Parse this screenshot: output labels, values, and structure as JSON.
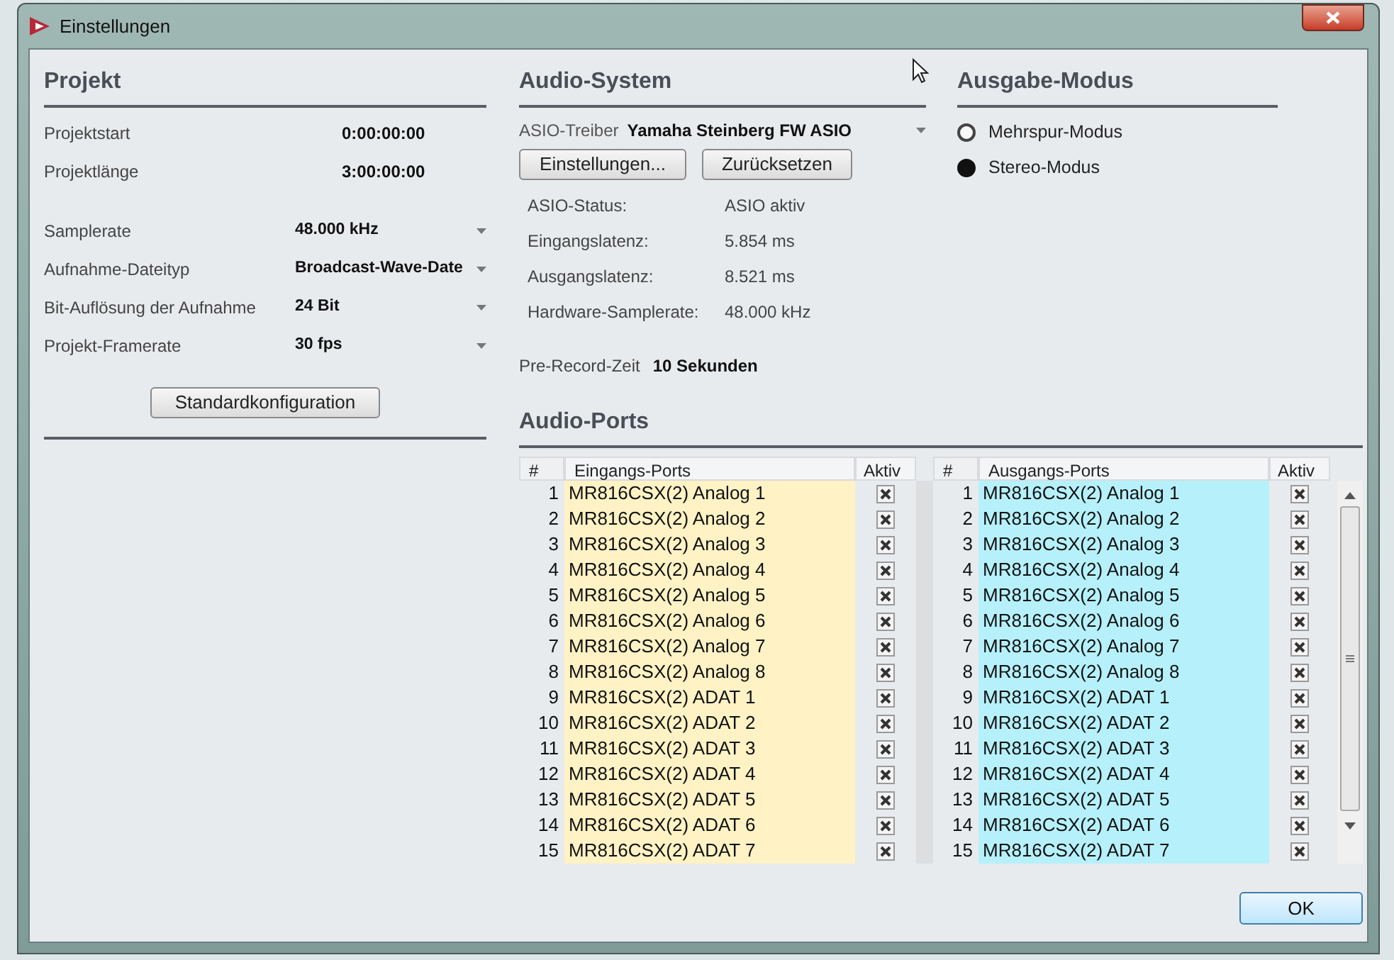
{
  "window": {
    "title": "Einstellungen"
  },
  "projekt": {
    "title": "Projekt",
    "times": [
      {
        "label": "Projektstart",
        "value": "0:00:00:00"
      },
      {
        "label": "Projektlänge",
        "value": "3:00:00:00"
      }
    ],
    "settings": [
      {
        "label": "Samplerate",
        "value": "48.000 kHz"
      },
      {
        "label": "Aufnahme-Dateityp",
        "value": "Broadcast-Wave-Date"
      },
      {
        "label": "Bit-Auflösung der Aufnahme",
        "value": "24 Bit"
      },
      {
        "label": "Projekt-Framerate",
        "value": "30 fps"
      }
    ],
    "button": "Standardkonfiguration"
  },
  "audio_system": {
    "title": "Audio-System",
    "driver_label": "ASIO-Treiber",
    "driver_value": "Yamaha Steinberg FW ASIO",
    "buttons": [
      "Einstellungen...",
      "Zurücksetzen"
    ],
    "status": [
      {
        "label": "ASIO-Status:",
        "value": "ASIO aktiv"
      },
      {
        "label": "Eingangslatenz:",
        "value": "5.854 ms"
      },
      {
        "label": "Ausgangslatenz:",
        "value": "8.521 ms"
      },
      {
        "label": "Hardware-Samplerate:",
        "value": "48.000 kHz"
      }
    ],
    "pre_record_label": "Pre-Record-Zeit",
    "pre_record_value": "10 Sekunden"
  },
  "ausgabe_modus": {
    "title": "Ausgabe-Modus",
    "options": [
      {
        "label": "Mehrspur-Modus",
        "selected": false
      },
      {
        "label": "Stereo-Modus",
        "selected": true
      }
    ]
  },
  "audio_ports": {
    "title": "Audio-Ports",
    "tables": [
      {
        "color": "#fff2c4",
        "columns": [
          "#",
          "Eingangs-Ports",
          "Aktiv"
        ],
        "rows": [
          {
            "number": "1",
            "name": "MR816CSX(2) Analog 1",
            "active": true
          },
          {
            "number": "2",
            "name": "MR816CSX(2) Analog 2",
            "active": true
          },
          {
            "number": "3",
            "name": "MR816CSX(2) Analog 3",
            "active": true
          },
          {
            "number": "4",
            "name": "MR816CSX(2) Analog 4",
            "active": true
          },
          {
            "number": "5",
            "name": "MR816CSX(2) Analog 5",
            "active": true
          },
          {
            "number": "6",
            "name": "MR816CSX(2) Analog 6",
            "active": true
          },
          {
            "number": "7",
            "name": "MR816CSX(2) Analog 7",
            "active": true
          },
          {
            "number": "8",
            "name": "MR816CSX(2) Analog 8",
            "active": true
          },
          {
            "number": "9",
            "name": "MR816CSX(2) ADAT 1",
            "active": true
          },
          {
            "number": "10",
            "name": "MR816CSX(2) ADAT 2",
            "active": true
          },
          {
            "number": "11",
            "name": "MR816CSX(2) ADAT 3",
            "active": true
          },
          {
            "number": "12",
            "name": "MR816CSX(2) ADAT 4",
            "active": true
          },
          {
            "number": "13",
            "name": "MR816CSX(2) ADAT 5",
            "active": true
          },
          {
            "number": "14",
            "name": "MR816CSX(2) ADAT 6",
            "active": true
          },
          {
            "number": "15",
            "name": "MR816CSX(2) ADAT 7",
            "active": true
          }
        ]
      },
      {
        "color": "#b6f1fb",
        "columns": [
          "#",
          "Ausgangs-Ports",
          "Aktiv"
        ],
        "rows": [
          {
            "number": "1",
            "name": "MR816CSX(2) Analog 1",
            "active": true
          },
          {
            "number": "2",
            "name": "MR816CSX(2) Analog 2",
            "active": true
          },
          {
            "number": "3",
            "name": "MR816CSX(2) Analog 3",
            "active": true
          },
          {
            "number": "4",
            "name": "MR816CSX(2) Analog 4",
            "active": true
          },
          {
            "number": "5",
            "name": "MR816CSX(2) Analog 5",
            "active": true
          },
          {
            "number": "6",
            "name": "MR816CSX(2) Analog 6",
            "active": true
          },
          {
            "number": "7",
            "name": "MR816CSX(2) Analog 7",
            "active": true
          },
          {
            "number": "8",
            "name": "MR816CSX(2) Analog 8",
            "active": true
          },
          {
            "number": "9",
            "name": "MR816CSX(2) ADAT 1",
            "active": true
          },
          {
            "number": "10",
            "name": "MR816CSX(2) ADAT 2",
            "active": true
          },
          {
            "number": "11",
            "name": "MR816CSX(2) ADAT 3",
            "active": true
          },
          {
            "number": "12",
            "name": "MR816CSX(2) ADAT 4",
            "active": true
          },
          {
            "number": "13",
            "name": "MR816CSX(2) ADAT 5",
            "active": true
          },
          {
            "number": "14",
            "name": "MR816CSX(2) ADAT 6",
            "active": true
          },
          {
            "number": "15",
            "name": "MR816CSX(2) ADAT 7",
            "active": true
          }
        ]
      }
    ]
  },
  "ok_button": "OK"
}
